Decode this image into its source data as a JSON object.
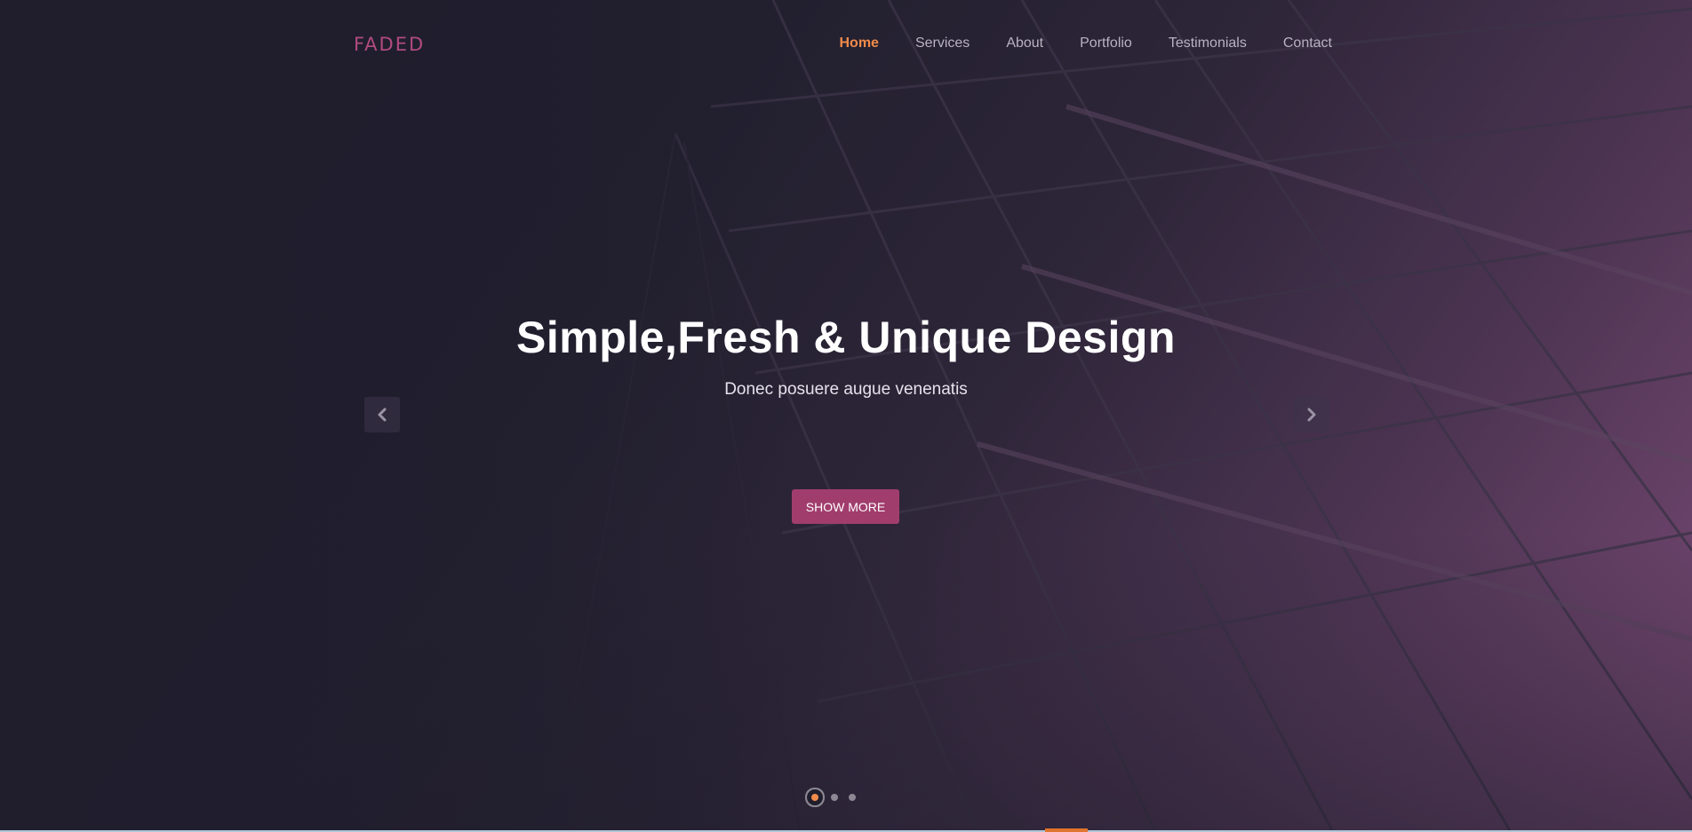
{
  "brand": {
    "logo_text": "FaDeD"
  },
  "nav": {
    "items": [
      {
        "label": "Home",
        "active": true
      },
      {
        "label": "Services",
        "active": false
      },
      {
        "label": "About",
        "active": false
      },
      {
        "label": "Portfolio",
        "active": false
      },
      {
        "label": "Testimonials",
        "active": false
      },
      {
        "label": "Contact",
        "active": false
      }
    ]
  },
  "slider": {
    "headline": "Simple,Fresh & Unique Design",
    "subline": "Donec posuere augue venenatis",
    "cta_label": "SHOW MORE",
    "prev_icon": "chevron-left-icon",
    "next_icon": "chevron-right-icon",
    "slide_count": 3,
    "active_slide": 1
  },
  "colors": {
    "accent": "#f08b4a",
    "brand": "#b04a80",
    "button": "#a13d6d",
    "background": "#201e2d"
  }
}
